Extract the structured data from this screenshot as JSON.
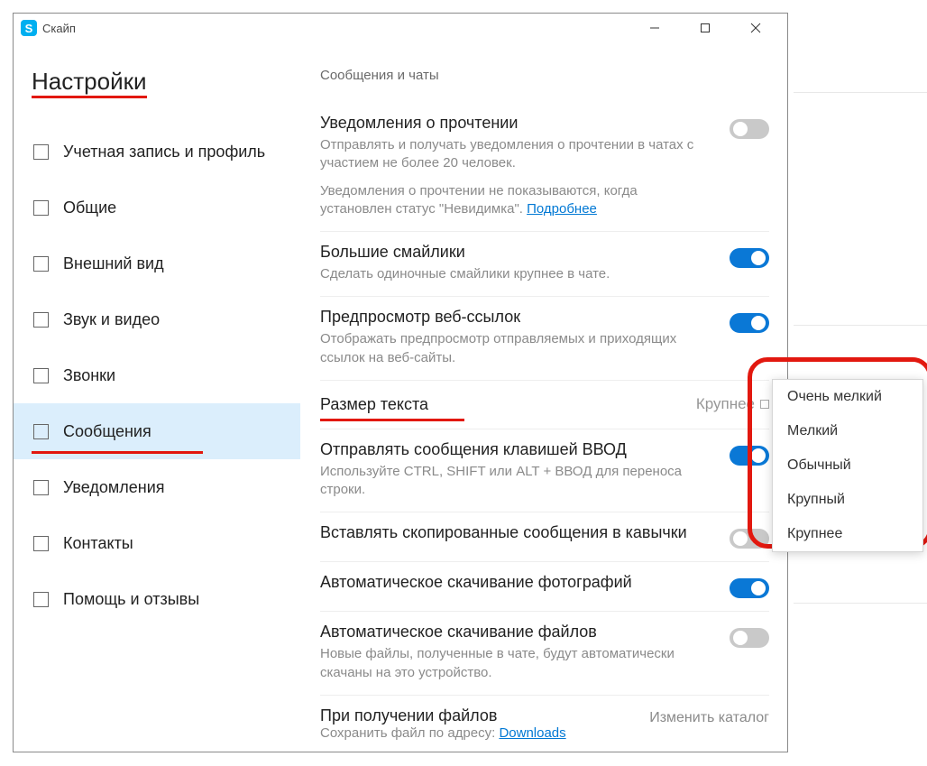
{
  "app": {
    "title": "Скайп"
  },
  "sidebar": {
    "title": "Настройки",
    "items": [
      {
        "label": "Учетная запись и профиль"
      },
      {
        "label": "Общие"
      },
      {
        "label": "Внешний вид"
      },
      {
        "label": "Звук и видео"
      },
      {
        "label": "Звонки"
      },
      {
        "label": "Сообщения"
      },
      {
        "label": "Уведомления"
      },
      {
        "label": "Контакты"
      },
      {
        "label": "Помощь и отзывы"
      }
    ]
  },
  "content": {
    "section_header": "Сообщения и чаты",
    "read_receipts": {
      "title": "Уведомления о прочтении",
      "desc": "Отправлять и получать уведомления о прочтении в чатах с участием не более 20 человек.",
      "note_prefix": "Уведомления о прочтении не показываются, когда установлен статус \"Невидимка\". ",
      "note_link": "Подробнее"
    },
    "big_emoji": {
      "title": "Большие смайлики",
      "desc": "Сделать одиночные смайлики крупнее в чате."
    },
    "web_preview": {
      "title": "Предпросмотр веб-ссылок",
      "desc": "Отображать предпросмотр отправляемых и приходящих ссылок на веб-сайты."
    },
    "text_size": {
      "title": "Размер текста",
      "value": "Крупнее"
    },
    "enter_send": {
      "title": "Отправлять сообщения клавишей ВВОД",
      "desc": "Используйте CTRL, SHIFT или ALT + ВВОД для переноса строки."
    },
    "paste_quotes": {
      "title": "Вставлять скопированные сообщения в кавычки"
    },
    "auto_photo": {
      "title": "Автоматическое скачивание фотографий"
    },
    "auto_files": {
      "title": "Автоматическое скачивание файлов",
      "desc": "Новые файлы, полученные в чате, будут автоматически скачаны на это устройство."
    },
    "on_receive": {
      "title": "При получении файлов",
      "desc_prefix": "Сохранить файл по адресу: ",
      "desc_link": "Downloads",
      "action": "Изменить каталог"
    }
  },
  "dropdown": {
    "items": [
      "Очень мелкий",
      "Мелкий",
      "Обычный",
      "Крупный",
      "Крупнее"
    ]
  }
}
